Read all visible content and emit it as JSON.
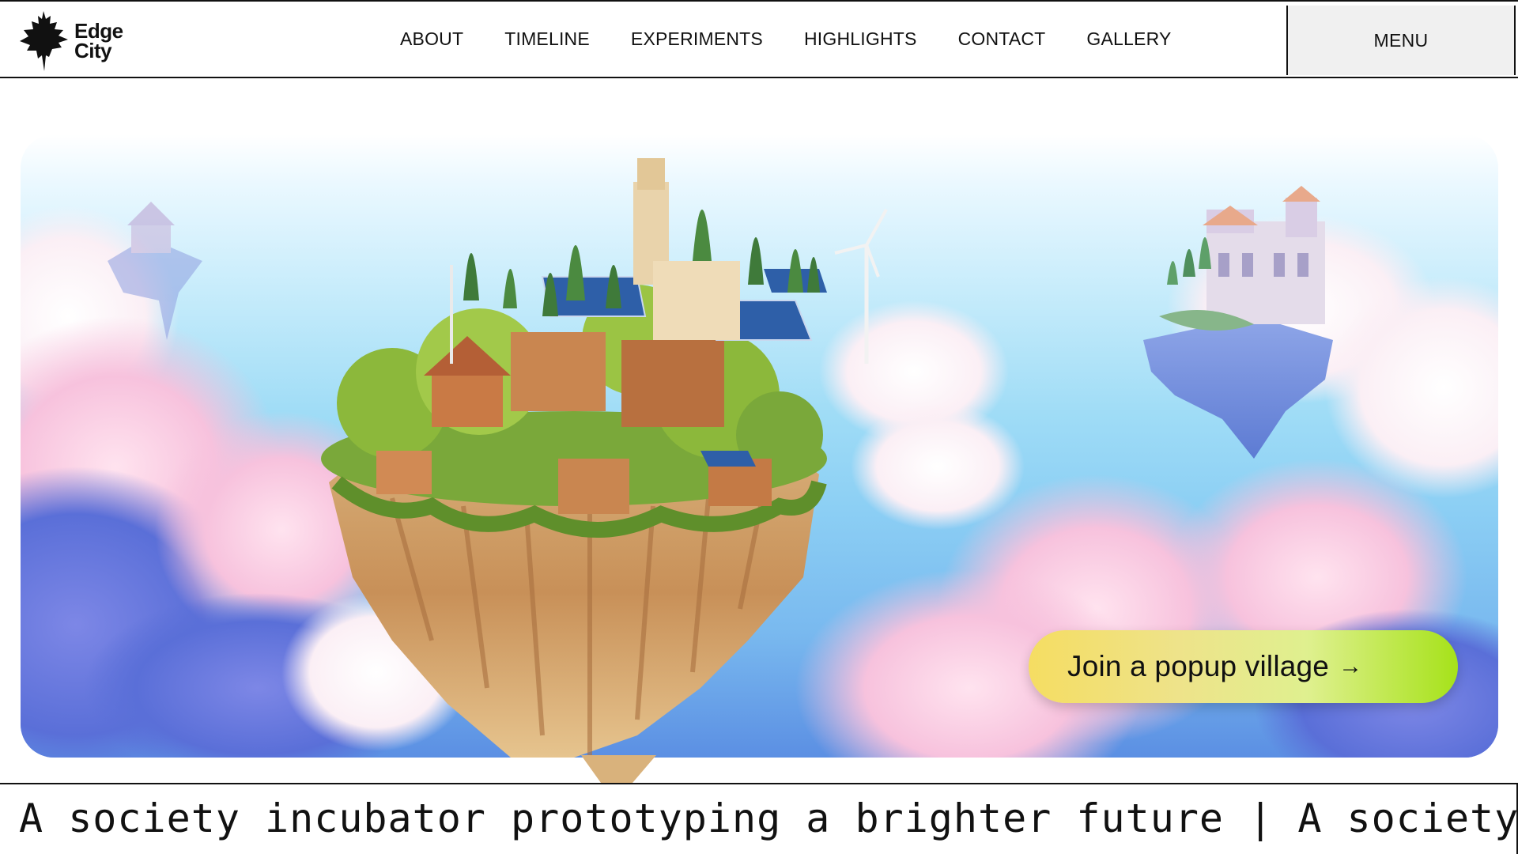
{
  "brand": {
    "line1": "Edge",
    "line2": "City"
  },
  "nav": {
    "items": [
      {
        "label": "ABOUT"
      },
      {
        "label": "TIMELINE"
      },
      {
        "label": "EXPERIMENTS"
      },
      {
        "label": "HIGHLIGHTS"
      },
      {
        "label": "CONTACT"
      },
      {
        "label": "GALLERY"
      }
    ],
    "menu_label": "MENU"
  },
  "hero": {
    "cta_label": "Join a popup village",
    "cta_arrow": "→"
  },
  "ticker": {
    "text": "A society incubator prototyping a brighter future | A society i"
  },
  "colors": {
    "border": "#111111",
    "cta_start": "#f5dd62",
    "cta_end": "#a6e21a",
    "menu_bg": "#f0f0f0"
  },
  "icons": [
    "edge-city-island-logo-icon",
    "arrow-right-icon"
  ]
}
